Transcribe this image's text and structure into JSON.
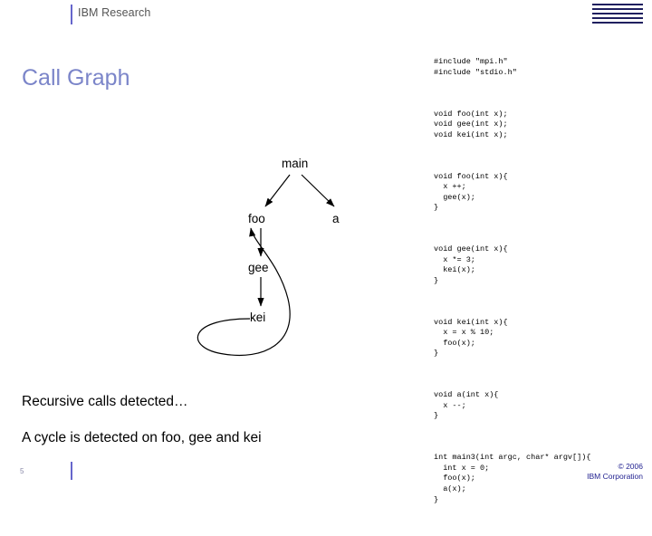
{
  "header": {
    "title": "IBM Research",
    "logo_text": "IBM"
  },
  "slide": {
    "title": "Call Graph",
    "caption1": "Recursive calls detected…",
    "caption2": "A cycle is detected on foo, gee and kei"
  },
  "code": {
    "block1": "#include \"mpi.h\"\n#include \"stdio.h\"",
    "block2": "void foo(int x);\nvoid gee(int x);\nvoid kei(int x);",
    "block3": "void foo(int x){\n  x ++;\n  gee(x);\n}",
    "block4": "void gee(int x){\n  x *= 3;\n  kei(x);\n}",
    "block5": "void kei(int x){\n  x = x % 10;\n  foo(x);\n}",
    "block6": "void a(int x){\n  x --;\n}",
    "block7": "int main3(int argc, char* argv[]){\n  int x = 0;\n  foo(x);\n  a(x);\n}"
  },
  "graph": {
    "nodes": [
      {
        "id": "main",
        "label": "main"
      },
      {
        "id": "foo",
        "label": "foo"
      },
      {
        "id": "a",
        "label": "a"
      },
      {
        "id": "gee",
        "label": "gee"
      },
      {
        "id": "kei",
        "label": "kei"
      }
    ],
    "edges": [
      {
        "from": "main",
        "to": "foo"
      },
      {
        "from": "main",
        "to": "a"
      },
      {
        "from": "foo",
        "to": "gee"
      },
      {
        "from": "gee",
        "to": "kei"
      },
      {
        "from": "kei",
        "to": "foo"
      }
    ]
  },
  "footer": {
    "page_number": "5",
    "copyright_line1": "© 2006",
    "copyright_line2": "IBM Corporation"
  },
  "colors": {
    "title": "#7b85c9",
    "rule": "#6666cc",
    "logo": "#1f1f5f",
    "copyright": "#1f1f8f"
  }
}
